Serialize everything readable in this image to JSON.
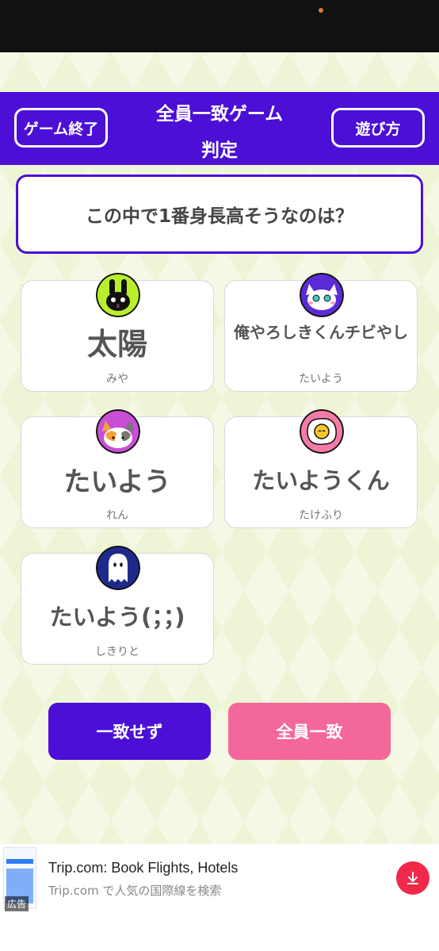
{
  "header": {
    "end_button": "ゲーム終了",
    "title_line1": "全員一致ゲーム",
    "title_line2": "判定",
    "rules_button": "遊び方"
  },
  "question": "この中で1番身長高そうなのは？",
  "answers": [
    {
      "answer": "太陽",
      "player": "みや",
      "avatar": "rabbit-icon"
    },
    {
      "answer": "俺やろしきくんチビやし",
      "player": "たいよう",
      "avatar": "cat-icon"
    },
    {
      "answer": "たいよう",
      "player": "れん",
      "avatar": "calico-cat-icon"
    },
    {
      "answer": "たいようくん",
      "player": "たけふり",
      "avatar": "fried-egg-icon"
    },
    {
      "answer": "たいよう(；；)",
      "player": "しきりと",
      "avatar": "ghost-icon"
    }
  ],
  "buttons": {
    "disagree": "一致せず",
    "agree": "全員一致"
  },
  "ad": {
    "tag": "広告",
    "title": "Trip.com: Book Flights, Hotels",
    "subtitle": "Trip.com で人気の国際線を検索"
  },
  "colors": {
    "accent": "#4b0fd6",
    "agree": "#f4679b",
    "background": "#eef5d6"
  }
}
